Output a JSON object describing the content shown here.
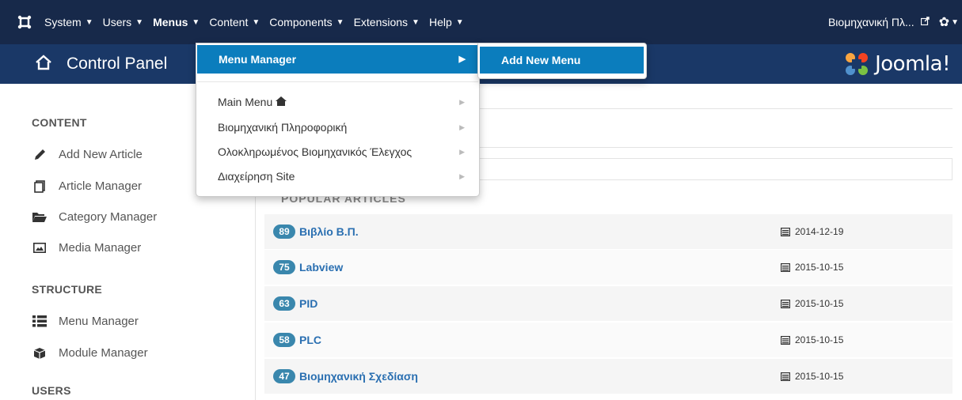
{
  "navbar": {
    "menus": [
      {
        "label": "System"
      },
      {
        "label": "Users"
      },
      {
        "label": "Menus"
      },
      {
        "label": "Content"
      },
      {
        "label": "Components"
      },
      {
        "label": "Extensions"
      },
      {
        "label": "Help"
      }
    ],
    "site_link": "Βιομηχανική Πλ..."
  },
  "header": {
    "title": "Control Panel",
    "logo_text": "Joomla!"
  },
  "dropdown": {
    "active_item": "Menu Manager",
    "items": [
      {
        "label": "Main Menu"
      },
      {
        "label": "Βιομηχανική Πληροφορική"
      },
      {
        "label": "Ολοκληρωμένος Βιομηχανικός Έλεγχος"
      },
      {
        "label": "Διαχείρηση Site"
      }
    ],
    "submenu_item": "Add New Menu"
  },
  "sidebar": {
    "content_heading": "CONTENT",
    "content_items": [
      {
        "label": "Add New Article",
        "icon": "pencil-icon"
      },
      {
        "label": "Article Manager",
        "icon": "stack-icon"
      },
      {
        "label": "Category Manager",
        "icon": "folder-icon"
      },
      {
        "label": "Media Manager",
        "icon": "image-icon"
      }
    ],
    "structure_heading": "STRUCTURE",
    "structure_items": [
      {
        "label": "Menu Manager",
        "icon": "list-icon"
      },
      {
        "label": "Module Manager",
        "icon": "cube-icon"
      }
    ],
    "users_heading": "USERS"
  },
  "popular": {
    "heading": "POPULAR ARTICLES",
    "articles": [
      {
        "hits": "89",
        "title": "Βιβλίο Β.Π.",
        "date": "2014-12-19"
      },
      {
        "hits": "75",
        "title": "Labview",
        "date": "2015-10-15"
      },
      {
        "hits": "63",
        "title": "PID",
        "date": "2015-10-15"
      },
      {
        "hits": "58",
        "title": "PLC",
        "date": "2015-10-15"
      },
      {
        "hits": "47",
        "title": "Βιομηχανική Σχεδίαση",
        "date": "2015-10-15"
      }
    ]
  },
  "colors": {
    "navbar_bg": "#17294a",
    "header_bg": "#1a3867",
    "menu_active": "#0b7dbd",
    "badge": "#3a87ad",
    "link": "#2a6fb1"
  }
}
